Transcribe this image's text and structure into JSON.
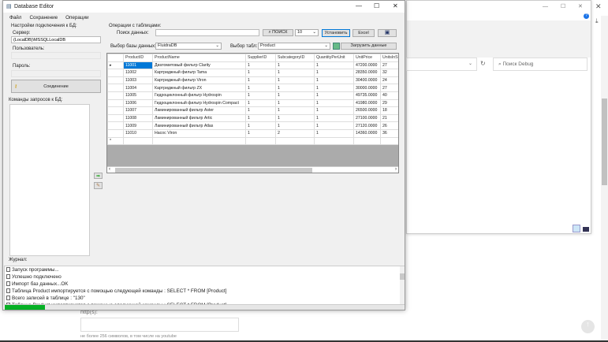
{
  "app": {
    "title": "Database Editor",
    "menu": [
      "Файл",
      "Сохранение",
      "Операции"
    ]
  },
  "connection": {
    "group_label": "Настройки подключения к БД:",
    "server_label": "Сервер:",
    "server_value": "(LocalDB)\\MSSQLLocalDB",
    "user_label": "Пользователь:",
    "user_value": "",
    "password_label": "Пароль:",
    "password_value": "",
    "connect_label": "Соединение",
    "commands_label": "Команды запросов к БД:"
  },
  "operations": {
    "group_label": "Операции с таблицами:",
    "search_label": "Поиск данных:",
    "search_value": "",
    "search_button": "ПОИСК",
    "count_value": "10",
    "set_button": "Установить",
    "excel_button": "Excel",
    "db_label": "Выбор базы данных:",
    "db_value": "FluidraDB",
    "table_label": "Выбор табл:",
    "table_value": "Product",
    "load_button": "Загрузить данные"
  },
  "grid": {
    "columns": [
      "ProductID",
      "ProductName",
      "SupplierID",
      "SubcategoryID",
      "QuantityPerUnit",
      "UnitPrice",
      "UnitsInSt"
    ],
    "rows": [
      [
        "11001",
        "Диатомитовый фильтр Clarity",
        "1",
        "1",
        "1",
        "47200.0000",
        "27"
      ],
      [
        "11002",
        "Картриджный фильтр Tama",
        "1",
        "1",
        "1",
        "28350.0000",
        "32"
      ],
      [
        "11003",
        "Картриджный фильтр Viron",
        "1",
        "1",
        "1",
        "30400.0000",
        "24"
      ],
      [
        "11004",
        "Картриджный фильтр ZX",
        "1",
        "1",
        "1",
        "30000.0000",
        "27"
      ],
      [
        "11005",
        "Гидроциклонный фильтр Hydrospin",
        "1",
        "1",
        "1",
        "49735.0000",
        "40"
      ],
      [
        "11006",
        "Гидроциклонный фильтр Hydrospin Compact",
        "1",
        "1",
        "1",
        "41980.0000",
        "29"
      ],
      [
        "11007",
        "Ламинированный фильтр Aster",
        "1",
        "1",
        "1",
        "26500.0000",
        "18"
      ],
      [
        "11008",
        "Ламинированный фильтр Artic",
        "1",
        "1",
        "1",
        "27100.0000",
        "21"
      ],
      [
        "11009",
        "Ламинированный фильтр Atlas",
        "1",
        "1",
        "1",
        "27120.0000",
        "26"
      ],
      [
        "11010",
        "Насос Viron",
        "1",
        "2",
        "1",
        "14360.0000",
        "36"
      ]
    ]
  },
  "journal": {
    "label": "Журнал:",
    "lines": [
      "Запуск программы...",
      "Успешно подключено",
      "Импорт баз данных...OK",
      "Таблица  Product импортируется с помощью следующей команды : SELECT * FROM [Product]",
      "Всего записей в таблице  : \"130\"",
      "Таблица  Product импортируется с помощью следующей команды : SELECT * FROM [Product]"
    ],
    "progress_percent": 10
  },
  "background": {
    "search_placeholder": "Поиск Debug",
    "url_label": "http(s):",
    "url_hint": "не более 256 символов, в том числе на youtube"
  },
  "colors": {
    "progress": "#06b025",
    "selection": "#0078d7"
  }
}
